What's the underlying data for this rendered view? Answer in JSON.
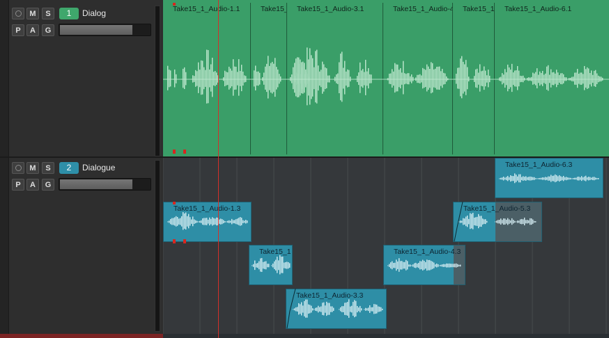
{
  "tracks": [
    {
      "number": "1",
      "name": "Dialog",
      "color": "#3fa76c",
      "buttons": {
        "record": "",
        "mute": "M",
        "solo": "S",
        "p": "P",
        "a": "A",
        "g": "G"
      },
      "clips": [
        {
          "label": "Take15_1_Audio-1.1"
        },
        {
          "label": "Take15_"
        },
        {
          "label": "Take15_1_Audio-3.1"
        },
        {
          "label": "Take15_1_Audio-4"
        },
        {
          "label": "Take15_1"
        },
        {
          "label": "Take15_1_Audio-6.1"
        }
      ]
    },
    {
      "number": "2",
      "name": "Dialogue",
      "color": "#2e8fa8",
      "buttons": {
        "record": "",
        "mute": "M",
        "solo": "S",
        "p": "P",
        "a": "A",
        "g": "G"
      },
      "clips": [
        {
          "label": "Take15_1_Audio-6.3"
        },
        {
          "label": "Take15_1_Audio-1.3"
        },
        {
          "label": "Take15_1_Audio-5.3"
        },
        {
          "label": "Take15_1"
        },
        {
          "label": "Take15_1_Audio-4.3"
        },
        {
          "label": "Take15_1_Audio-3.3"
        }
      ]
    }
  ],
  "colors": {
    "playhead": "#d3302a",
    "green_clip": "#3a9e68",
    "blue_clip": "#2e8ea6"
  }
}
